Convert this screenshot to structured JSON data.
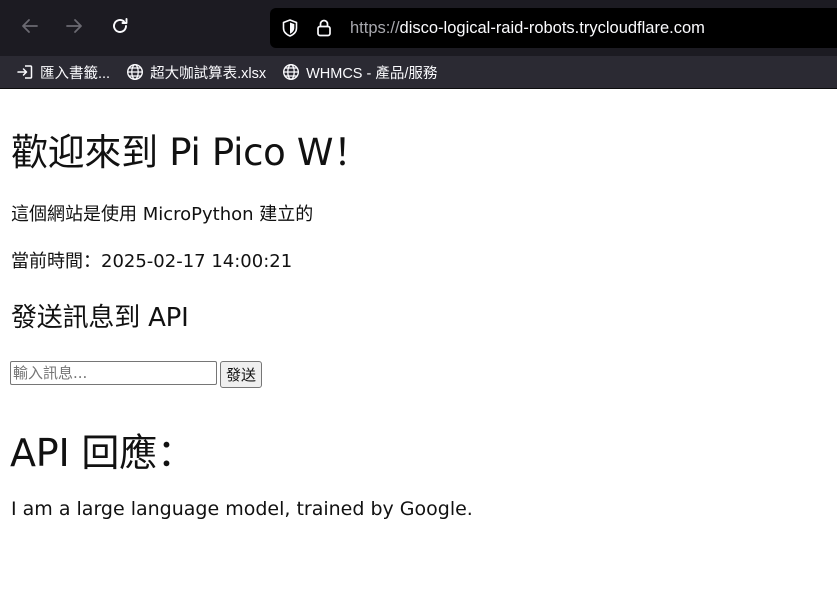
{
  "browser": {
    "url_scheme": "https://",
    "url_host": "disco-logical-raid-robots.trycloudflare.com",
    "bookmarks": [
      {
        "label": "匯入書籤...",
        "icon": "import-icon"
      },
      {
        "label": "超大咖試算表.xlsx",
        "icon": "globe-icon"
      },
      {
        "label": "WHMCS - 產品/服務",
        "icon": "globe-icon"
      }
    ]
  },
  "page": {
    "title": "歡迎來到 Pi Pico W！",
    "subtitle": "這個網站是使用 MicroPython 建立的",
    "time_label": "當前時間：2025-02-17 14:00:21",
    "form": {
      "heading": "發送訊息到 API",
      "placeholder": "輸入訊息...",
      "value": "",
      "send_label": "發送"
    },
    "response": {
      "heading": "API 回應：",
      "text": "I am a large language model, trained by Google."
    }
  },
  "colors": {
    "chrome_bg": "#1c1b22",
    "bookmarks_bg": "#2b2a33",
    "urlbar_bg": "#000000",
    "chrome_text": "#fbfbfe",
    "disabled_icon": "#6b6a72"
  }
}
